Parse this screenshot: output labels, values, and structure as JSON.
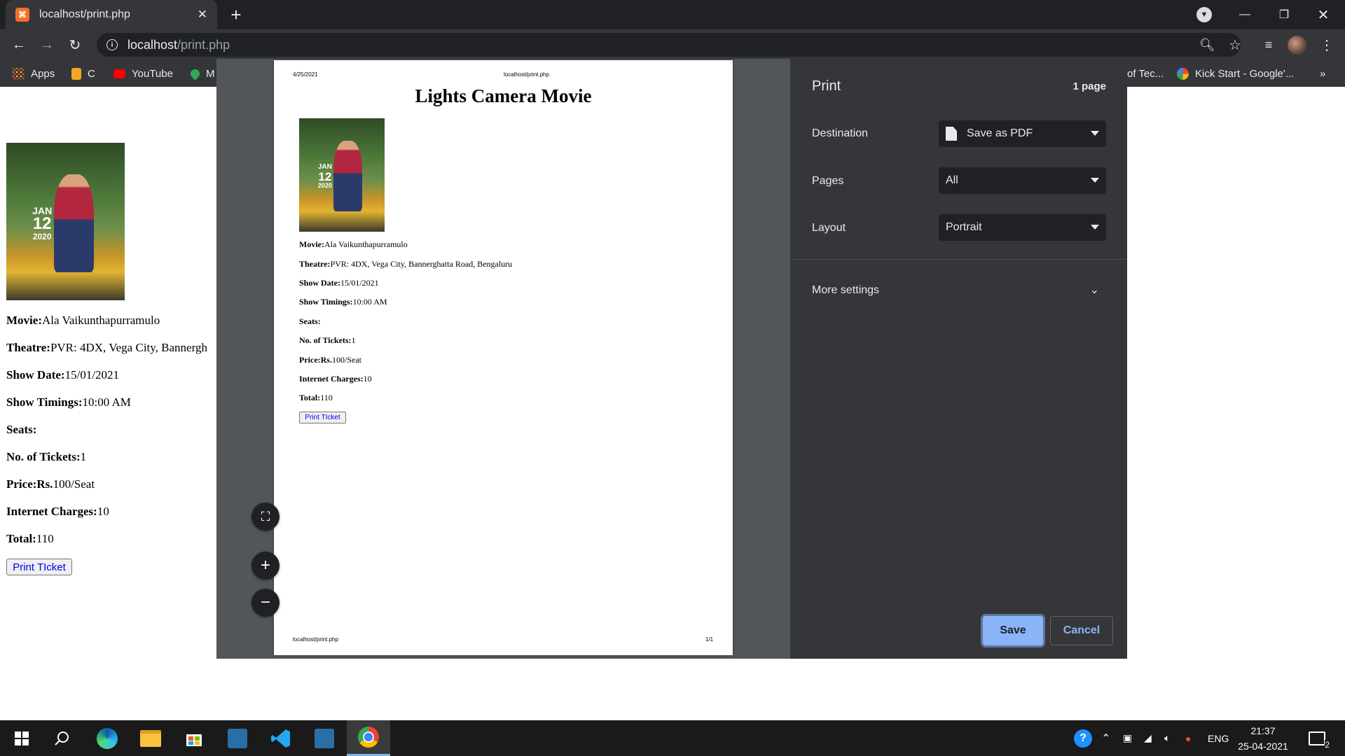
{
  "browser": {
    "tab_title": "localhost/print.php",
    "tab_close": "✕",
    "new_tab": "+",
    "url_host": "localhost",
    "url_path": "/print.php",
    "favicon_text": "⌘"
  },
  "bookmarks": [
    {
      "label": "Apps",
      "icon": "apps-grid-icon"
    },
    {
      "label": "C",
      "icon": "bookmark-c-icon"
    },
    {
      "label": "YouTube",
      "icon": "youtube-icon"
    },
    {
      "label": "M",
      "icon": "maps-pin-icon"
    },
    {
      "label": "of Tec...",
      "icon": "none"
    },
    {
      "label": "Kick Start - Google'...",
      "icon": "google-icon"
    },
    {
      "label": "»",
      "icon": "more-bookmarks-icon"
    }
  ],
  "page": {
    "poster_month": "JAN",
    "poster_day": "12",
    "poster_year": "2020",
    "lines": [
      {
        "label": "Movie:",
        "value": "Ala Vaikunthapurramulo"
      },
      {
        "label": "Theatre:",
        "value": "PVR: 4DX, Vega City, Bannergh"
      },
      {
        "label": "Show Date:",
        "value": "15/01/2021"
      },
      {
        "label": "Show Timings:",
        "value": "10:00 AM"
      },
      {
        "label": "Seats:",
        "value": ""
      },
      {
        "label": "No. of Tickets:",
        "value": "1"
      },
      {
        "label": "Price:Rs.",
        "value": "100/Seat"
      },
      {
        "label": "Internet Charges:",
        "value": "10"
      },
      {
        "label": "Total:",
        "value": "110"
      }
    ],
    "print_button": "Print TIcket"
  },
  "preview": {
    "header_date": "4/25/2021",
    "header_url": "localhost/print.php",
    "title": "Lights Camera Movie",
    "lines": [
      {
        "label": "Movie:",
        "value": "Ala Vaikunthapurramulo"
      },
      {
        "label": "Theatre:",
        "value": "PVR: 4DX, Vega City, Bannerghatta Road, Bengaluru"
      },
      {
        "label": "Show Date:",
        "value": "15/01/2021"
      },
      {
        "label": "Show Timings:",
        "value": "10:00 AM"
      },
      {
        "label": "Seats:",
        "value": ""
      },
      {
        "label": "No. of Tickets:",
        "value": "1"
      },
      {
        "label": "Price:Rs.",
        "value": "100/Seat"
      },
      {
        "label": "Internet Charges:",
        "value": "10"
      },
      {
        "label": "Total:",
        "value": "110"
      }
    ],
    "print_button": "Print TIcket",
    "footer_url": "localhost/print.php",
    "footer_page": "1/1"
  },
  "print_panel": {
    "title": "Print",
    "page_count": "1 page",
    "destination_label": "Destination",
    "destination_value": "Save as PDF",
    "pages_label": "Pages",
    "pages_value": "All",
    "layout_label": "Layout",
    "layout_value": "Portrait",
    "more_settings": "More settings",
    "save": "Save",
    "cancel": "Cancel"
  },
  "taskbar": {
    "language": "ENG",
    "time": "21:37",
    "date": "25-04-2021",
    "notification_count": "2"
  },
  "colors": {
    "chrome_dark": "#202124",
    "chrome_toolbar": "#35363a",
    "accent_blue": "#8ab4f8",
    "preview_bg": "#525659"
  }
}
